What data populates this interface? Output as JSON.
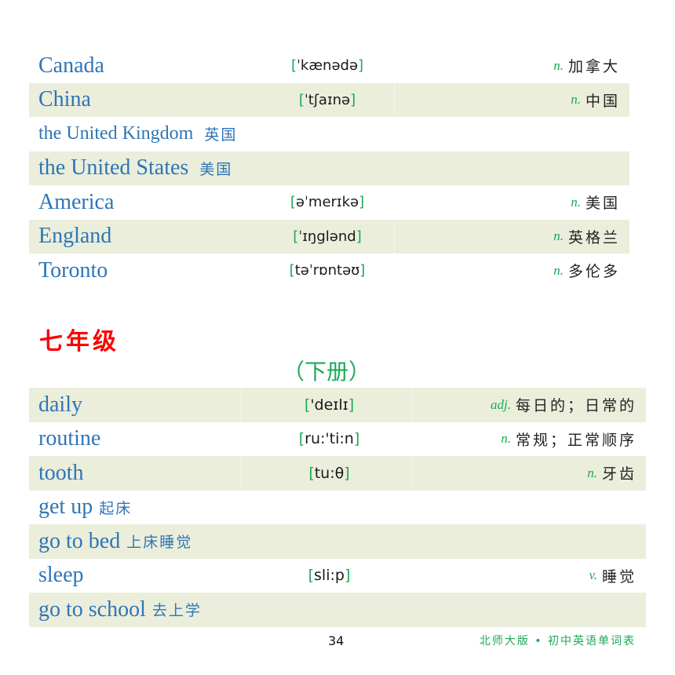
{
  "top_table": {
    "rows": [
      {
        "word": "Canada",
        "phonetic": "ˈkænədə",
        "pos": "n.",
        "meaning": "加拿大",
        "shaded": false
      },
      {
        "word": "China",
        "phonetic": "ˈtʃaɪnə",
        "pos": "n.",
        "meaning": "中国",
        "shaded": true
      },
      {
        "word": "the United Kingdom",
        "inline_meaning": "英国",
        "shaded": false
      },
      {
        "word": "the United States",
        "inline_meaning": "美国",
        "shaded": true
      },
      {
        "word": "America",
        "phonetic": "əˈmerɪkə",
        "pos": "n.",
        "meaning": "美国",
        "shaded": false
      },
      {
        "word": "England",
        "phonetic": "ˈɪŋglənd",
        "pos": "n.",
        "meaning": "英格兰",
        "shaded": true
      },
      {
        "word": "Toronto",
        "phonetic": "təˈrɒntəʊ",
        "pos": "n.",
        "meaning": "多伦多",
        "shaded": false
      }
    ]
  },
  "section": {
    "grade": "七年级",
    "volume": "（下册）"
  },
  "bottom_table": {
    "rows": [
      {
        "word": "daily",
        "phonetic": "'deɪlɪ",
        "pos": "adj.",
        "meaning": "每日的；日常的",
        "shaded": true
      },
      {
        "word": "routine",
        "phonetic": "ru:'ti:n",
        "pos": "n.",
        "meaning": "常规；正常顺序",
        "shaded": false
      },
      {
        "word": "tooth",
        "phonetic": "tu:θ",
        "pos": "n.",
        "meaning": "牙齿",
        "shaded": true
      },
      {
        "word": "get up",
        "inline_meaning": "起床",
        "shaded": false
      },
      {
        "word": "go to bed",
        "inline_meaning": "上床睡觉",
        "shaded": true
      },
      {
        "word": "sleep",
        "phonetic": "sli:p",
        "pos": "v.",
        "meaning": "睡觉",
        "shaded": false
      },
      {
        "word": "go to school",
        "inline_meaning": "去上学",
        "shaded": true
      }
    ]
  },
  "footer": {
    "page_number": "34",
    "book_title": "北师大版 • 初中英语单词表"
  },
  "colors": {
    "word": "#2e75b6",
    "accent_green": "#1aaa55",
    "grade_red": "#ff0000",
    "row_shade": "#eaeedb"
  }
}
